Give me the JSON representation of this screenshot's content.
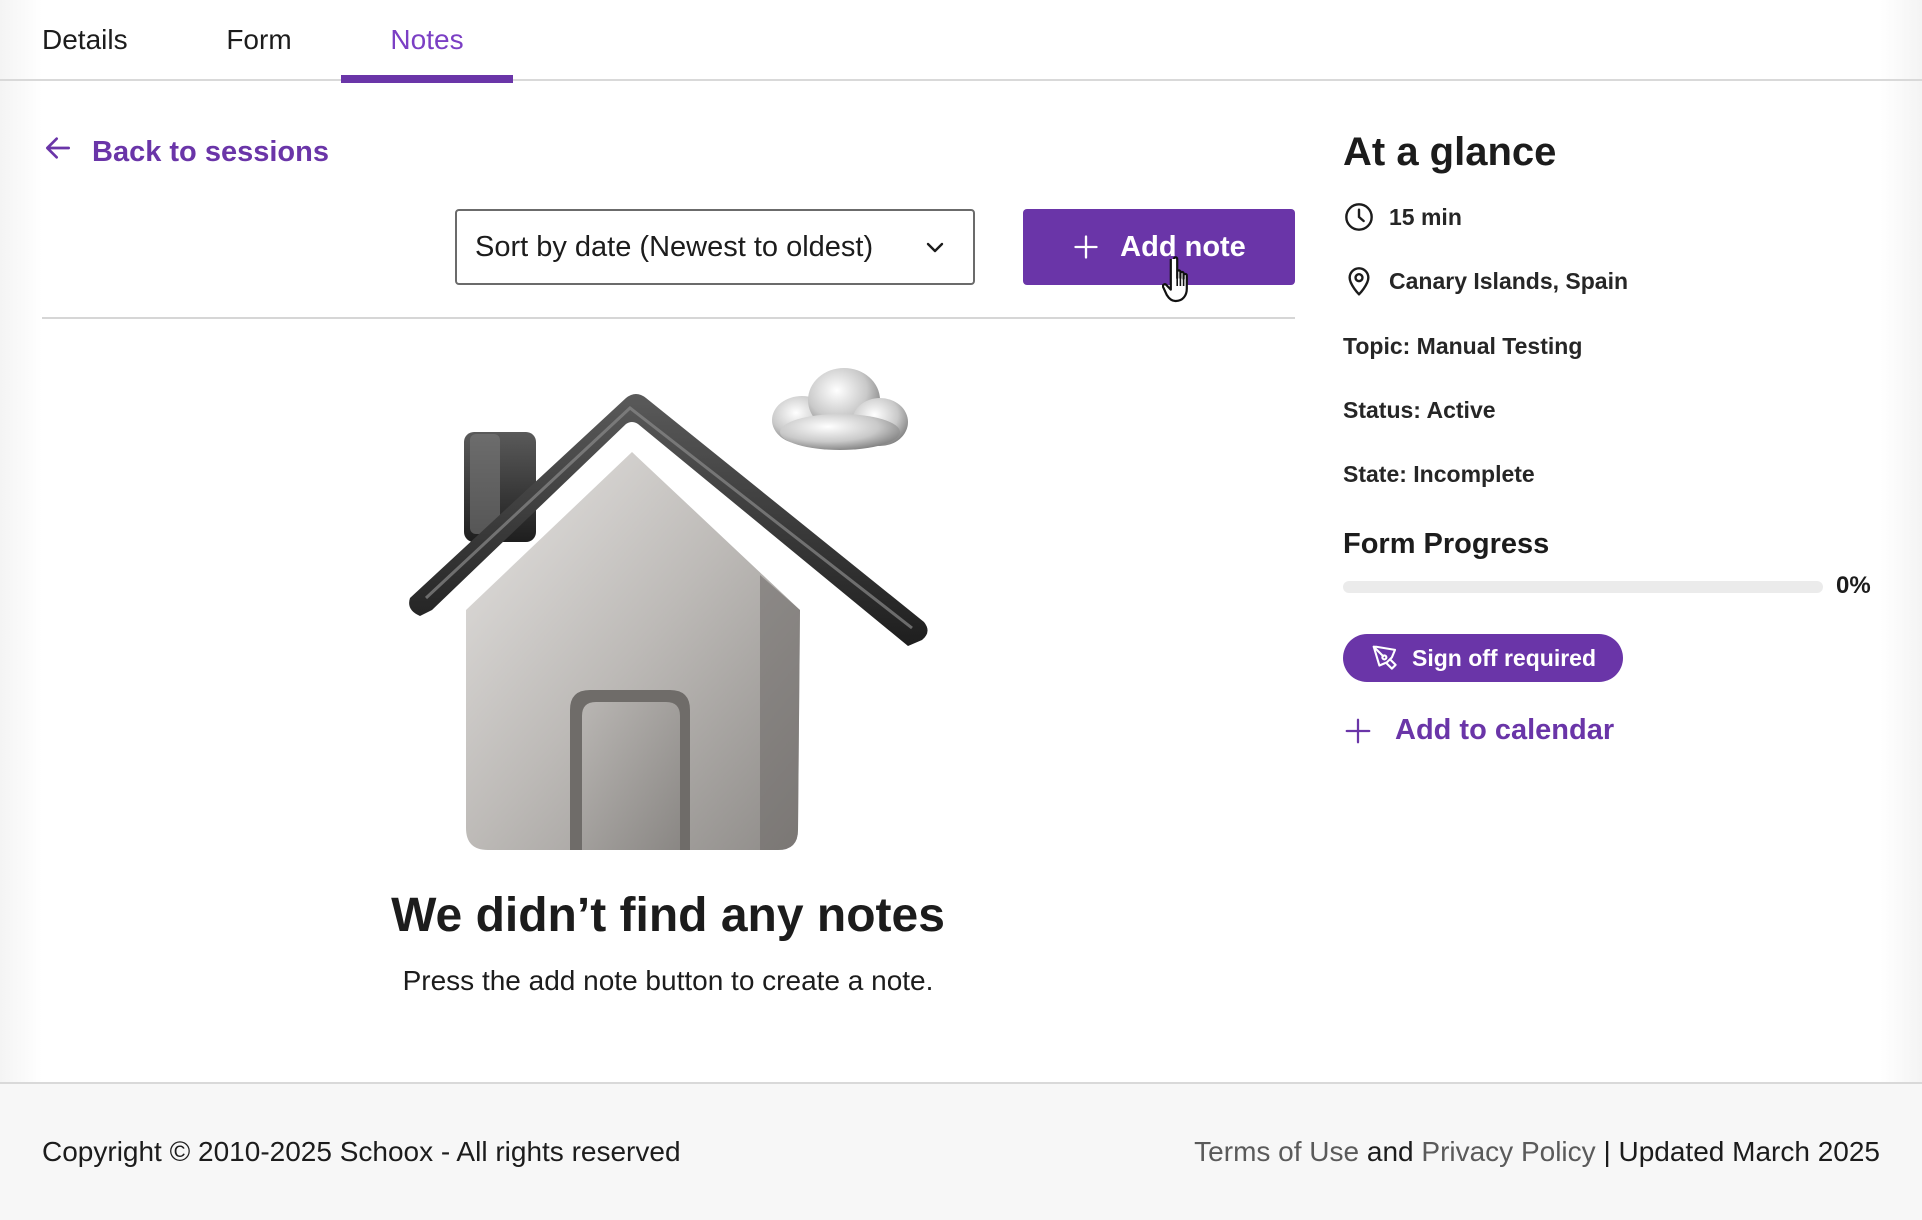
{
  "tabs": [
    {
      "label": "Details"
    },
    {
      "label": "Form"
    },
    {
      "label": "Notes",
      "active": true
    }
  ],
  "back_link": {
    "label": "Back to sessions",
    "icon": "arrow-left-icon"
  },
  "toolbar": {
    "sort_value": "Sort by date (Newest to oldest)",
    "add_note_label": "Add note"
  },
  "empty_state": {
    "title": "We didn’t find any notes",
    "subtitle": "Press the add note button to create a note.",
    "illustration": "house-with-cloud-illustration"
  },
  "glance": {
    "title": "At a glance",
    "duration": "15 min",
    "location": "Canary Islands, Spain",
    "topic": "Topic: Manual Testing",
    "status": "Status: Active",
    "state": "State: Incomplete",
    "progress_title": "Form Progress",
    "progress_value": 0,
    "progress_label": "0%",
    "signoff_label": "Sign off required",
    "add_calendar_label": "Add to calendar"
  },
  "footer": {
    "copyright": "Copyright © 2010-2025 Schoox - All rights reserved",
    "terms": "Terms of Use",
    "and": "and",
    "privacy": "Privacy Policy",
    "updated": "| Updated March 2025"
  },
  "colors": {
    "accent": "#6a35a8",
    "active_tab_text": "#7b3fc4"
  }
}
